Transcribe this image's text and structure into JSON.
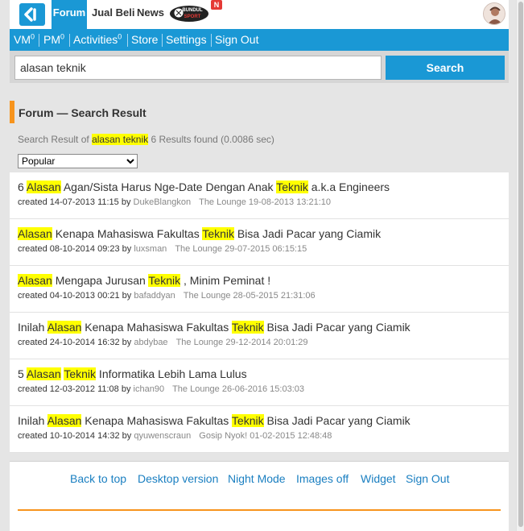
{
  "header": {
    "tabs": [
      {
        "label": "Forum",
        "active": true
      },
      {
        "label": "Jual Beli"
      },
      {
        "label": "News"
      }
    ],
    "badge_label": "N",
    "brand_text": "BUNDUL SPORT"
  },
  "nav": {
    "vm_label": "VM",
    "vm_count": "0",
    "pm_label": "PM",
    "pm_count": "0",
    "activities_label": "Activities",
    "activities_count": "0",
    "store_label": "Store",
    "settings_label": "Settings",
    "signout_label": "Sign Out"
  },
  "search": {
    "value": "alasan teknik",
    "button_label": "Search"
  },
  "page": {
    "title": "Forum — Search Result",
    "summary_prefix": "Search Result of",
    "summary_query": "alasan teknik",
    "summary_suffix": "6 Results found (0.0086 sec)",
    "sort_selected": "Popular"
  },
  "results": [
    {
      "title_parts": [
        {
          "t": "6 "
        },
        {
          "t": "Alasan",
          "h": true
        },
        {
          "t": " Agan/Sista Harus Nge-Date Dengan Anak "
        },
        {
          "t": "Teknik",
          "h": true
        },
        {
          "t": " a.k.a Engineers"
        }
      ],
      "created": "created 14-07-2013 11:15 by",
      "user": "DukeBlangkon",
      "forum": "The Lounge 19-08-2013 13:21:10"
    },
    {
      "title_parts": [
        {
          "t": "Alasan",
          "h": true
        },
        {
          "t": " Kenapa Mahasiswa Fakultas "
        },
        {
          "t": "Teknik",
          "h": true
        },
        {
          "t": " Bisa Jadi Pacar yang Ciamik"
        }
      ],
      "created": "created 08-10-2014 09:23 by",
      "user": "luxsman",
      "forum": "The Lounge 29-07-2015 06:15:15"
    },
    {
      "title_parts": [
        {
          "t": "Alasan",
          "h": true
        },
        {
          "t": " Mengapa Jurusan "
        },
        {
          "t": "Teknik",
          "h": true
        },
        {
          "t": " , Minim Peminat !"
        }
      ],
      "created": "created 04-10-2013 00:21 by",
      "user": "bafaddyan",
      "forum": "The Lounge 28-05-2015 21:31:06"
    },
    {
      "title_parts": [
        {
          "t": "Inilah "
        },
        {
          "t": "Alasan",
          "h": true
        },
        {
          "t": " Kenapa Mahasiswa Fakultas "
        },
        {
          "t": "Teknik",
          "h": true
        },
        {
          "t": " Bisa Jadi Pacar yang Ciamik"
        }
      ],
      "created": "created 24-10-2014 16:32 by",
      "user": "abdybae",
      "forum": "The Lounge 29-12-2014 20:01:29"
    },
    {
      "title_parts": [
        {
          "t": "5 "
        },
        {
          "t": "Alasan",
          "h": true
        },
        {
          "t": " "
        },
        {
          "t": "Teknik",
          "h": true
        },
        {
          "t": " Informatika Lebih Lama Lulus"
        }
      ],
      "created": "created 12-03-2012 11:08 by",
      "user": "ichan90",
      "forum": "The Lounge 26-06-2016 15:03:03"
    },
    {
      "title_parts": [
        {
          "t": "Inilah "
        },
        {
          "t": "Alasan",
          "h": true
        },
        {
          "t": " Kenapa Mahasiswa Fakultas "
        },
        {
          "t": "Teknik",
          "h": true
        },
        {
          "t": " Bisa Jadi Pacar yang Ciamik"
        }
      ],
      "created": "created 10-10-2014 14:32 by",
      "user": "qyuwenscraun",
      "forum": "Gosip Nyok! 01-02-2015 12:48:48"
    }
  ],
  "footer": {
    "links": [
      "Back to top",
      "Desktop version",
      "Night Mode",
      "Images off",
      "Widget",
      "Sign Out"
    ]
  },
  "colors": {
    "brand_blue": "#1a98d5",
    "accent_orange": "#f7941d",
    "highlight": "#ffff00",
    "link_blue": "#1a7fc1"
  },
  "icons": {
    "logo": "kaskus-logo-icon",
    "avatar": "user-avatar"
  }
}
